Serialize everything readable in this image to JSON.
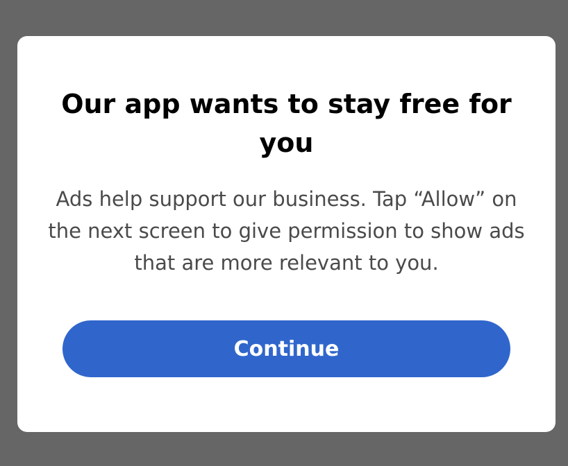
{
  "dialog": {
    "title": "Our app wants to stay free for you",
    "body": "Ads help support our business. Tap “Allow” on the next screen to give permission to show ads that are more relevant to you.",
    "continue_label": "Continue"
  },
  "colors": {
    "backdrop": "#666666",
    "dialog_background": "#ffffff",
    "button_background": "#3066cc",
    "button_text": "#ffffff",
    "title_text": "#000000",
    "body_text": "#4a4a4a"
  }
}
